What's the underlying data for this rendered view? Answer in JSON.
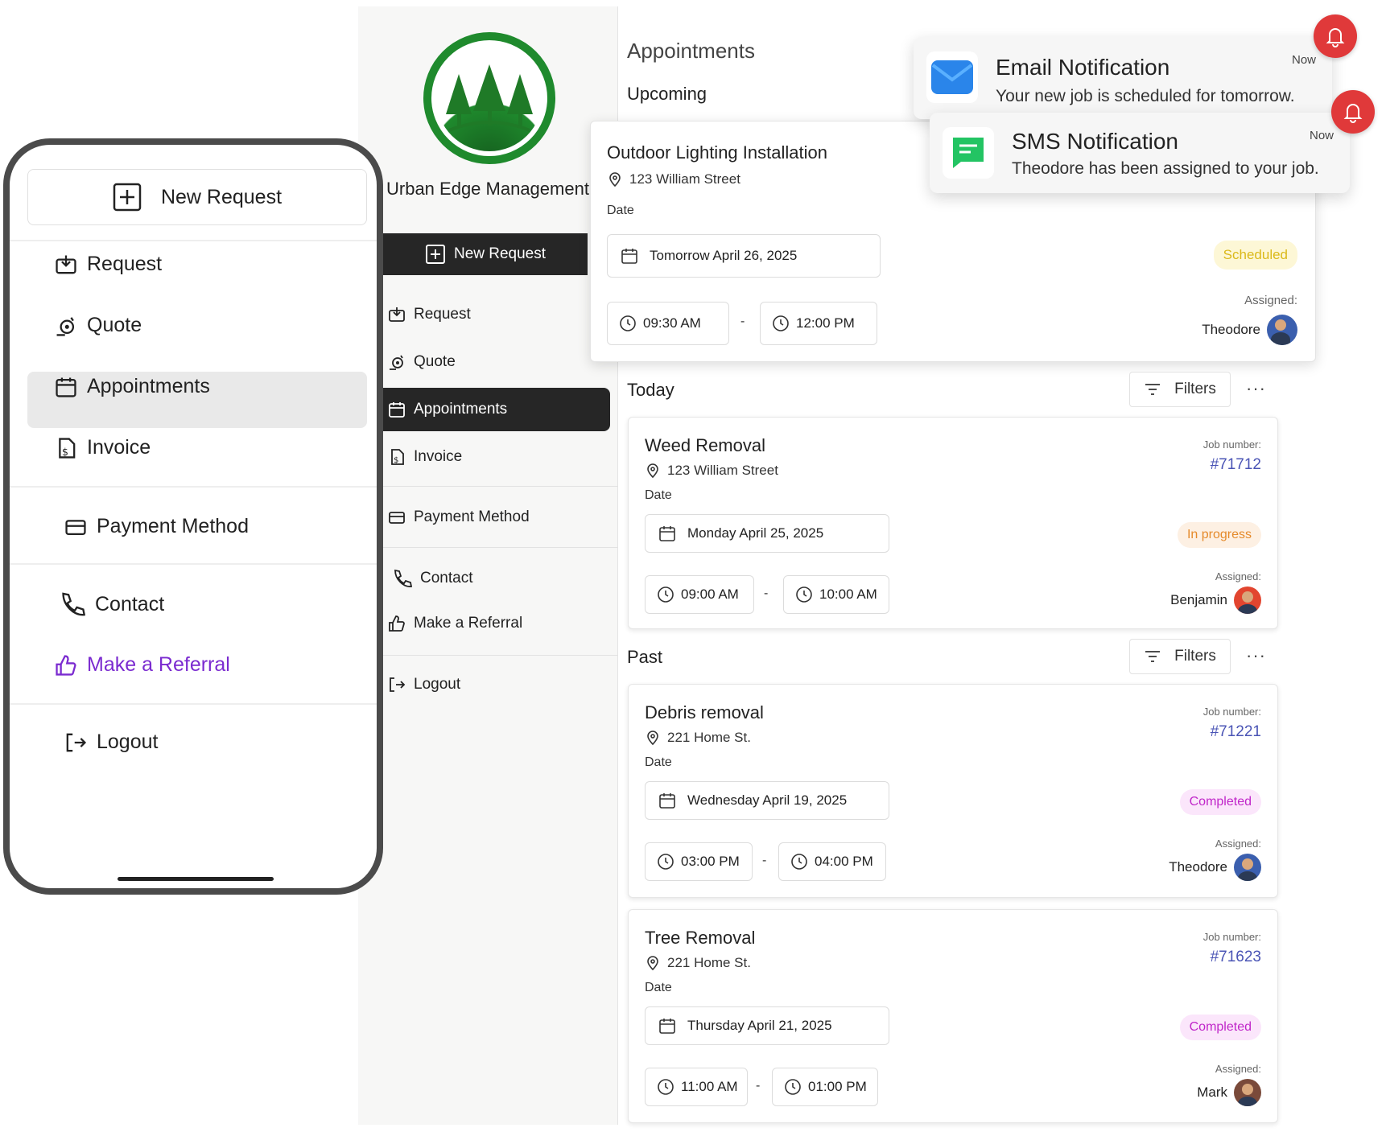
{
  "brand": {
    "name": "Urban Edge Management",
    "logo_icon": "pine-trees-logo",
    "accent": "#1f8a2d"
  },
  "sidebar": {
    "new_request": "New Request",
    "items": [
      {
        "label": "Request",
        "icon": "inbox-download-icon"
      },
      {
        "label": "Quote",
        "icon": "quote-target-icon"
      },
      {
        "label": "Appointments",
        "icon": "calendar-icon",
        "active": true
      },
      {
        "label": "Invoice",
        "icon": "invoice-dollar-icon"
      },
      {
        "label": "Payment Method",
        "icon": "credit-card-icon"
      },
      {
        "label": "Contact",
        "icon": "phone-icon"
      },
      {
        "label": "Make a Referral",
        "icon": "thumbs-up-icon"
      },
      {
        "label": "Logout",
        "icon": "logout-icon"
      }
    ]
  },
  "phone_menu": {
    "new_request": "New Request",
    "items": [
      {
        "label": "Request"
      },
      {
        "label": "Quote"
      },
      {
        "label": "Appointments",
        "active": true
      },
      {
        "label": "Invoice"
      },
      {
        "label": "Payment Method"
      },
      {
        "label": "Contact"
      },
      {
        "label": "Make a Referral",
        "color": "#7b2bd0"
      },
      {
        "label": "Logout"
      }
    ]
  },
  "main": {
    "title": "Appointments",
    "upcoming_label": "Upcoming",
    "today_label": "Today",
    "past_label": "Past",
    "filters_label": "Filters",
    "more_label": "···",
    "date_label": "Date",
    "job_number_label": "Job number:",
    "assigned_label": "Assigned:",
    "upcoming": {
      "title": "Outdoor Lighting Installation",
      "address": "123 William Street",
      "date": "Tomorrow April 26, 2025",
      "start": "09:30 AM",
      "end": "12:00 PM",
      "status": "Scheduled",
      "assigned": "Theodore"
    },
    "today": [
      {
        "title": "Weed Removal",
        "address": "123 William Street",
        "date": "Monday April 25, 2025",
        "start": "09:00 AM",
        "end": "10:00 AM",
        "job_number": "#71712",
        "status": "In progress",
        "assigned": "Benjamin"
      }
    ],
    "past": [
      {
        "title": "Debris removal",
        "address": "221 Home St.",
        "date": "Wednesday April 19, 2025",
        "start": "03:00 PM",
        "end": "04:00 PM",
        "job_number": "#71221",
        "status": "Completed",
        "assigned": "Theodore"
      },
      {
        "title": "Tree Removal",
        "address": "221 Home St.",
        "date": "Thursday April 21, 2025",
        "start": "11:00 AM",
        "end": "01:00 PM",
        "job_number": "#71623",
        "status": "Completed",
        "assigned": "Mark"
      }
    ]
  },
  "notifications": [
    {
      "title": "Email Notification",
      "text": "Your new job is scheduled for tomorrow.",
      "time": "Now",
      "icon": "email-app-icon"
    },
    {
      "title": "SMS Notification",
      "text": "Theodore has been assigned to your job.",
      "time": "Now",
      "icon": "sms-app-icon"
    }
  ],
  "colors": {
    "in_progress": "#e58a2b",
    "completed": "#c026c9",
    "scheduled": "#dbb91a",
    "job_number": "#4a54b5",
    "bell": "#e0393a"
  }
}
